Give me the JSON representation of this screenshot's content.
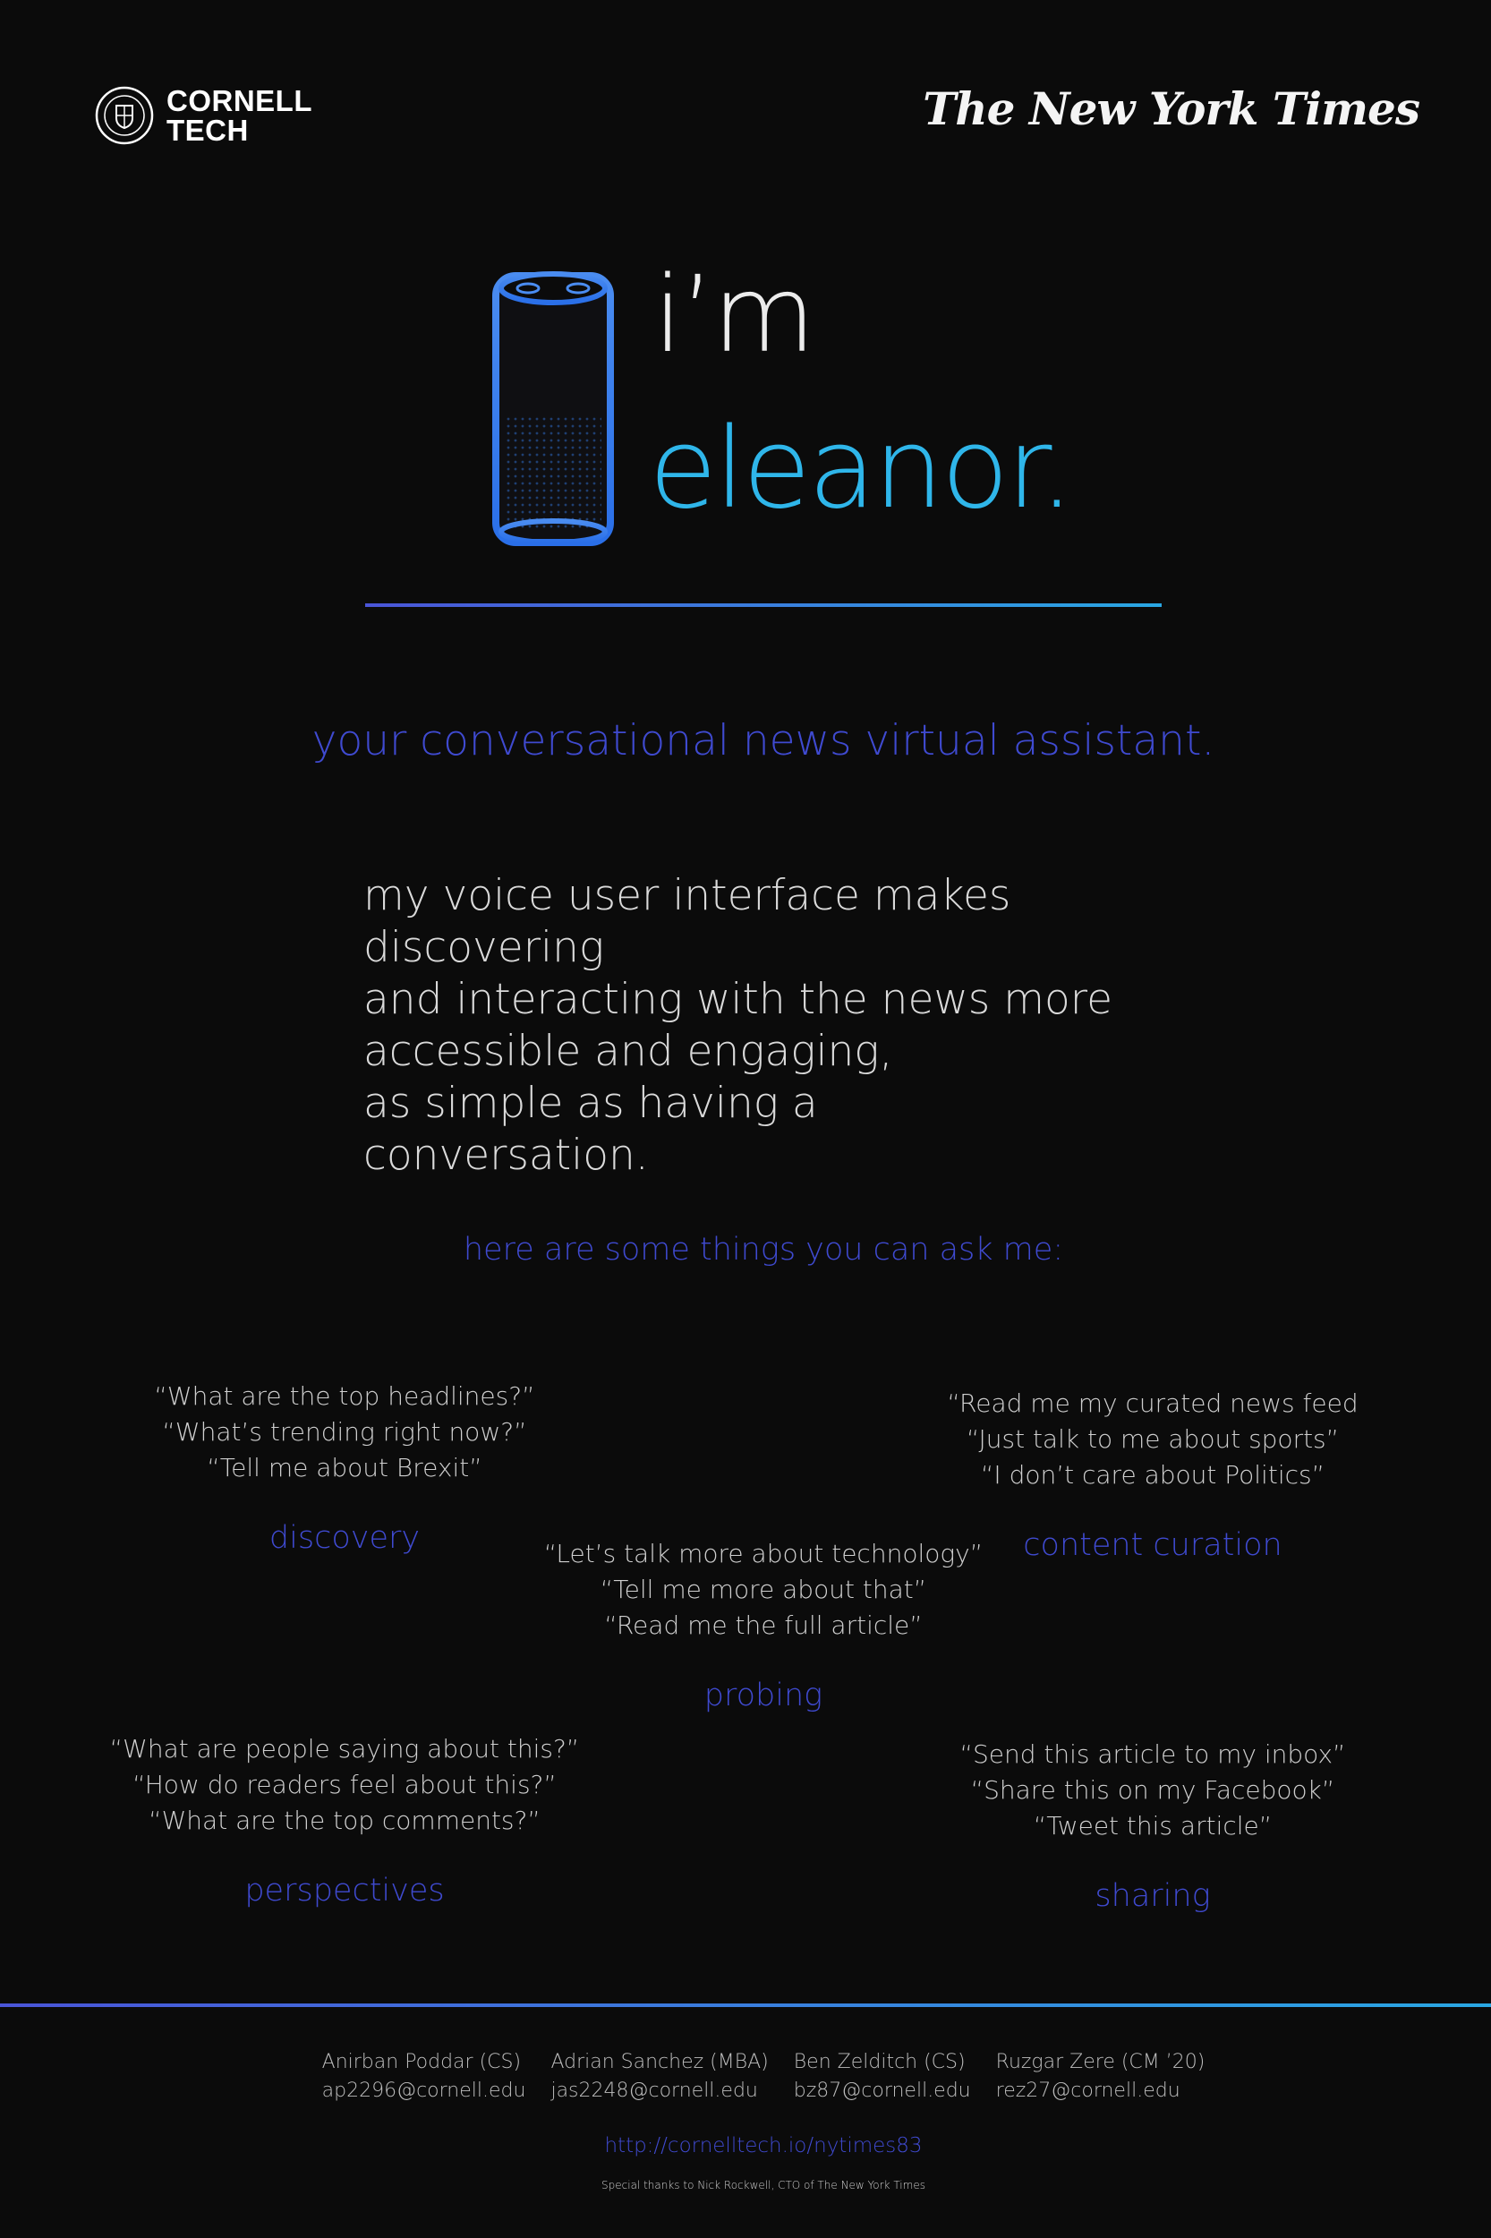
{
  "header": {
    "cornell_line1": "CORNELL",
    "cornell_line2": "TECH",
    "nyt": "The New York Times",
    "seal_text": "CORNELL UNIVERSITY FOUNDED A.D. 1865"
  },
  "hero": {
    "im": "i’m",
    "name": "eleanor."
  },
  "tagline": "your conversational news virtual assistant.",
  "intro": "my voice user interface makes discovering\nand interacting with the news more\naccessible and engaging,\nas simple as having a\nconversation.",
  "ask_heading": "here are some things you can ask me:",
  "groups": {
    "discovery": {
      "questions": [
        "“What are the top headlines?”",
        "“What’s trending right now?”",
        "“Tell me about Brexit”"
      ],
      "label": "discovery"
    },
    "curation": {
      "questions": [
        "“Read me my curated news feed",
        "“Just talk to me about sports”",
        "“I don’t care about Politics”"
      ],
      "label": "content curation"
    },
    "probing": {
      "questions": [
        "“Let’s talk more about technology”",
        "“Tell me more about that”",
        "“Read me the full article”"
      ],
      "label": "probing"
    },
    "perspectives": {
      "questions": [
        "“What are people saying about this?”",
        "“How do readers feel about this?”",
        "“What are the top comments?”"
      ],
      "label": "perspectives"
    },
    "sharing": {
      "questions": [
        "“Send this article to my inbox”",
        "“Share this on my Facebook”",
        "“Tweet this article”"
      ],
      "label": "sharing"
    }
  },
  "authors": [
    {
      "name": "Anirban Poddar (CS)",
      "email": "ap2296@cornell.edu"
    },
    {
      "name": "Adrian Sanchez (MBA)",
      "email": "jas2248@cornell.edu"
    },
    {
      "name": "Ben Zelditch (CS)",
      "email": "bz87@cornell.edu"
    },
    {
      "name": "Ruzgar Zere (CM ’20)",
      "email": "rez27@cornell.edu"
    }
  ],
  "url": "http://cornelltech.io/nytimes83",
  "thanks": "Special thanks to Nick Rockwell,  CTO of The New York Times",
  "colors": {
    "background": "#0b0b0b",
    "accent_blue": "#3f4ad0",
    "accent_cyan": "#2fb6ea"
  }
}
